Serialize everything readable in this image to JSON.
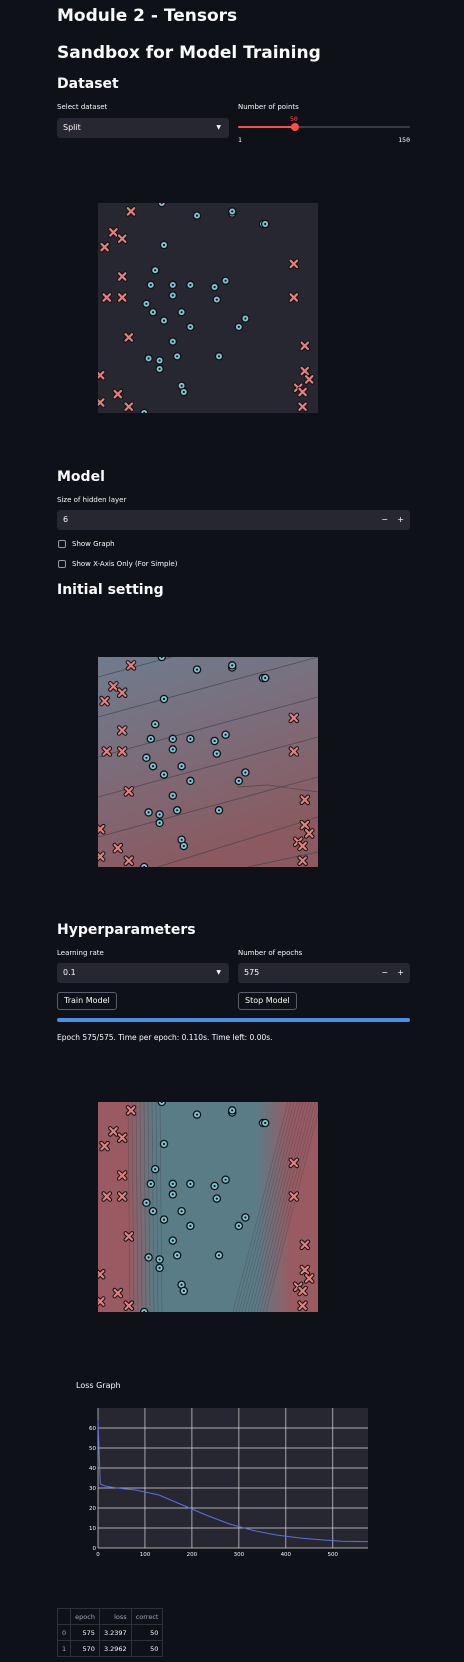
{
  "page": {
    "title": "Module 2 - Tensors",
    "sandbox_title": "Sandbox for Model Training"
  },
  "dataset": {
    "heading": "Dataset",
    "select_label": "Select dataset",
    "select_value": "Split",
    "points_label": "Number of points",
    "points_value": 50,
    "points_value_text": "50",
    "points_min": "1",
    "points_max": "150"
  },
  "model": {
    "heading": "Model",
    "hidden_label": "Size of hidden layer",
    "hidden_value": "6",
    "minus": "−",
    "plus": "+",
    "show_graph_label": "Show Graph",
    "show_xaxis_label": "Show X-Axis Only (For Simple)"
  },
  "initial": {
    "heading": "Initial setting"
  },
  "hyper": {
    "heading": "Hyperparameters",
    "lr_label": "Learning rate",
    "lr_value": "0.1",
    "epochs_label": "Number of epochs",
    "epochs_value": "575",
    "minus": "−",
    "plus": "+",
    "train_label": "Train Model",
    "stop_label": "Stop Model",
    "progress": 1.0,
    "status": "Epoch 575/575. Time per epoch: 0.110s. Time left: 0.00s."
  },
  "colors": {
    "accent": "#ff4b4b",
    "progress": "#4c8fea",
    "class0": "#7fc4d6",
    "class1": "#e0807f"
  },
  "scatter": {
    "class0_points": [
      [
        0.29,
        0.0
      ],
      [
        0.45,
        0.06
      ],
      [
        0.61,
        0.05
      ],
      [
        0.61,
        0.04
      ],
      [
        0.75,
        0.1
      ],
      [
        0.76,
        0.1
      ],
      [
        0.3,
        0.2
      ],
      [
        0.26,
        0.32
      ],
      [
        0.24,
        0.39
      ],
      [
        0.34,
        0.39
      ],
      [
        0.42,
        0.39
      ],
      [
        0.53,
        0.4
      ],
      [
        0.58,
        0.37
      ],
      [
        0.34,
        0.44
      ],
      [
        0.22,
        0.48
      ],
      [
        0.54,
        0.46
      ],
      [
        0.38,
        0.52
      ],
      [
        0.25,
        0.52
      ],
      [
        0.67,
        0.55
      ],
      [
        0.3,
        0.56
      ],
      [
        0.42,
        0.59
      ],
      [
        0.64,
        0.59
      ],
      [
        0.34,
        0.66
      ],
      [
        0.23,
        0.74
      ],
      [
        0.28,
        0.75
      ],
      [
        0.36,
        0.73
      ],
      [
        0.55,
        0.73
      ],
      [
        0.28,
        0.79
      ],
      [
        0.38,
        0.87
      ],
      [
        0.39,
        0.9
      ],
      [
        0.21,
        1.0
      ]
    ],
    "class1_points": [
      [
        0.15,
        0.04
      ],
      [
        0.07,
        0.14
      ],
      [
        0.11,
        0.17
      ],
      [
        0.03,
        0.21
      ],
      [
        0.11,
        0.35
      ],
      [
        0.04,
        0.45
      ],
      [
        0.11,
        0.45
      ],
      [
        0.89,
        0.29
      ],
      [
        0.89,
        0.45
      ],
      [
        0.14,
        0.64
      ],
      [
        0.94,
        0.68
      ],
      [
        0.94,
        0.8
      ],
      [
        0.96,
        0.84
      ],
      [
        0.01,
        0.82
      ],
      [
        0.09,
        0.91
      ],
      [
        0.91,
        0.88
      ],
      [
        0.93,
        0.9
      ],
      [
        0.01,
        0.95
      ],
      [
        0.14,
        0.97
      ],
      [
        0.93,
        0.97
      ]
    ]
  },
  "loss_chart": {
    "title": "Loss Graph",
    "chart_data": {
      "type": "line",
      "x": [
        0,
        5,
        15,
        40,
        80,
        130,
        180,
        230,
        280,
        330,
        380,
        430,
        480,
        520,
        575
      ],
      "y": [
        64,
        32,
        31,
        30,
        29,
        26.5,
        21.5,
        16.5,
        12.0,
        8.8,
        6.5,
        5.0,
        4.0,
        3.4,
        3.2
      ],
      "xlim": [
        0,
        575
      ],
      "ylim": [
        0,
        70
      ],
      "xticks": [
        "0",
        "100",
        "200",
        "300",
        "400",
        "500"
      ],
      "yticks": [
        "0",
        "10",
        "20",
        "30",
        "40",
        "50",
        "60"
      ],
      "grid": true
    }
  },
  "table": {
    "headers": [
      "",
      "epoch",
      "loss",
      "correct"
    ],
    "rows": [
      [
        "0",
        "575",
        "3.2397",
        "50"
      ],
      [
        "1",
        "570",
        "3.2962",
        "50"
      ]
    ]
  }
}
